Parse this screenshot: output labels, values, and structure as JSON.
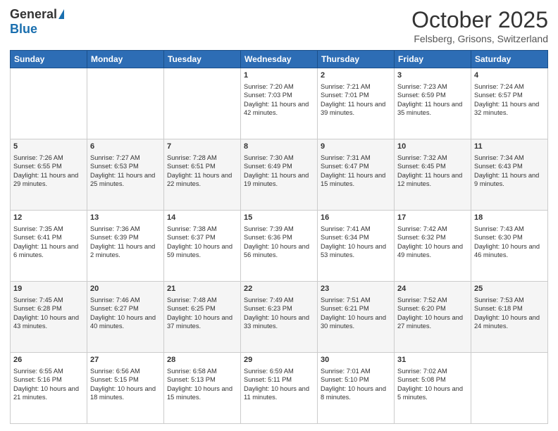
{
  "logo": {
    "general": "General",
    "blue": "Blue"
  },
  "header": {
    "month": "October 2025",
    "location": "Felsberg, Grisons, Switzerland"
  },
  "weekdays": [
    "Sunday",
    "Monday",
    "Tuesday",
    "Wednesday",
    "Thursday",
    "Friday",
    "Saturday"
  ],
  "weeks": [
    [
      {
        "day": "",
        "sunrise": "",
        "sunset": "",
        "daylight": ""
      },
      {
        "day": "",
        "sunrise": "",
        "sunset": "",
        "daylight": ""
      },
      {
        "day": "",
        "sunrise": "",
        "sunset": "",
        "daylight": ""
      },
      {
        "day": "1",
        "sunrise": "Sunrise: 7:20 AM",
        "sunset": "Sunset: 7:03 PM",
        "daylight": "Daylight: 11 hours and 42 minutes."
      },
      {
        "day": "2",
        "sunrise": "Sunrise: 7:21 AM",
        "sunset": "Sunset: 7:01 PM",
        "daylight": "Daylight: 11 hours and 39 minutes."
      },
      {
        "day": "3",
        "sunrise": "Sunrise: 7:23 AM",
        "sunset": "Sunset: 6:59 PM",
        "daylight": "Daylight: 11 hours and 35 minutes."
      },
      {
        "day": "4",
        "sunrise": "Sunrise: 7:24 AM",
        "sunset": "Sunset: 6:57 PM",
        "daylight": "Daylight: 11 hours and 32 minutes."
      }
    ],
    [
      {
        "day": "5",
        "sunrise": "Sunrise: 7:26 AM",
        "sunset": "Sunset: 6:55 PM",
        "daylight": "Daylight: 11 hours and 29 minutes."
      },
      {
        "day": "6",
        "sunrise": "Sunrise: 7:27 AM",
        "sunset": "Sunset: 6:53 PM",
        "daylight": "Daylight: 11 hours and 25 minutes."
      },
      {
        "day": "7",
        "sunrise": "Sunrise: 7:28 AM",
        "sunset": "Sunset: 6:51 PM",
        "daylight": "Daylight: 11 hours and 22 minutes."
      },
      {
        "day": "8",
        "sunrise": "Sunrise: 7:30 AM",
        "sunset": "Sunset: 6:49 PM",
        "daylight": "Daylight: 11 hours and 19 minutes."
      },
      {
        "day": "9",
        "sunrise": "Sunrise: 7:31 AM",
        "sunset": "Sunset: 6:47 PM",
        "daylight": "Daylight: 11 hours and 15 minutes."
      },
      {
        "day": "10",
        "sunrise": "Sunrise: 7:32 AM",
        "sunset": "Sunset: 6:45 PM",
        "daylight": "Daylight: 11 hours and 12 minutes."
      },
      {
        "day": "11",
        "sunrise": "Sunrise: 7:34 AM",
        "sunset": "Sunset: 6:43 PM",
        "daylight": "Daylight: 11 hours and 9 minutes."
      }
    ],
    [
      {
        "day": "12",
        "sunrise": "Sunrise: 7:35 AM",
        "sunset": "Sunset: 6:41 PM",
        "daylight": "Daylight: 11 hours and 6 minutes."
      },
      {
        "day": "13",
        "sunrise": "Sunrise: 7:36 AM",
        "sunset": "Sunset: 6:39 PM",
        "daylight": "Daylight: 11 hours and 2 minutes."
      },
      {
        "day": "14",
        "sunrise": "Sunrise: 7:38 AM",
        "sunset": "Sunset: 6:37 PM",
        "daylight": "Daylight: 10 hours and 59 minutes."
      },
      {
        "day": "15",
        "sunrise": "Sunrise: 7:39 AM",
        "sunset": "Sunset: 6:36 PM",
        "daylight": "Daylight: 10 hours and 56 minutes."
      },
      {
        "day": "16",
        "sunrise": "Sunrise: 7:41 AM",
        "sunset": "Sunset: 6:34 PM",
        "daylight": "Daylight: 10 hours and 53 minutes."
      },
      {
        "day": "17",
        "sunrise": "Sunrise: 7:42 AM",
        "sunset": "Sunset: 6:32 PM",
        "daylight": "Daylight: 10 hours and 49 minutes."
      },
      {
        "day": "18",
        "sunrise": "Sunrise: 7:43 AM",
        "sunset": "Sunset: 6:30 PM",
        "daylight": "Daylight: 10 hours and 46 minutes."
      }
    ],
    [
      {
        "day": "19",
        "sunrise": "Sunrise: 7:45 AM",
        "sunset": "Sunset: 6:28 PM",
        "daylight": "Daylight: 10 hours and 43 minutes."
      },
      {
        "day": "20",
        "sunrise": "Sunrise: 7:46 AM",
        "sunset": "Sunset: 6:27 PM",
        "daylight": "Daylight: 10 hours and 40 minutes."
      },
      {
        "day": "21",
        "sunrise": "Sunrise: 7:48 AM",
        "sunset": "Sunset: 6:25 PM",
        "daylight": "Daylight: 10 hours and 37 minutes."
      },
      {
        "day": "22",
        "sunrise": "Sunrise: 7:49 AM",
        "sunset": "Sunset: 6:23 PM",
        "daylight": "Daylight: 10 hours and 33 minutes."
      },
      {
        "day": "23",
        "sunrise": "Sunrise: 7:51 AM",
        "sunset": "Sunset: 6:21 PM",
        "daylight": "Daylight: 10 hours and 30 minutes."
      },
      {
        "day": "24",
        "sunrise": "Sunrise: 7:52 AM",
        "sunset": "Sunset: 6:20 PM",
        "daylight": "Daylight: 10 hours and 27 minutes."
      },
      {
        "day": "25",
        "sunrise": "Sunrise: 7:53 AM",
        "sunset": "Sunset: 6:18 PM",
        "daylight": "Daylight: 10 hours and 24 minutes."
      }
    ],
    [
      {
        "day": "26",
        "sunrise": "Sunrise: 6:55 AM",
        "sunset": "Sunset: 5:16 PM",
        "daylight": "Daylight: 10 hours and 21 minutes."
      },
      {
        "day": "27",
        "sunrise": "Sunrise: 6:56 AM",
        "sunset": "Sunset: 5:15 PM",
        "daylight": "Daylight: 10 hours and 18 minutes."
      },
      {
        "day": "28",
        "sunrise": "Sunrise: 6:58 AM",
        "sunset": "Sunset: 5:13 PM",
        "daylight": "Daylight: 10 hours and 15 minutes."
      },
      {
        "day": "29",
        "sunrise": "Sunrise: 6:59 AM",
        "sunset": "Sunset: 5:11 PM",
        "daylight": "Daylight: 10 hours and 11 minutes."
      },
      {
        "day": "30",
        "sunrise": "Sunrise: 7:01 AM",
        "sunset": "Sunset: 5:10 PM",
        "daylight": "Daylight: 10 hours and 8 minutes."
      },
      {
        "day": "31",
        "sunrise": "Sunrise: 7:02 AM",
        "sunset": "Sunset: 5:08 PM",
        "daylight": "Daylight: 10 hours and 5 minutes."
      },
      {
        "day": "",
        "sunrise": "",
        "sunset": "",
        "daylight": ""
      }
    ]
  ]
}
